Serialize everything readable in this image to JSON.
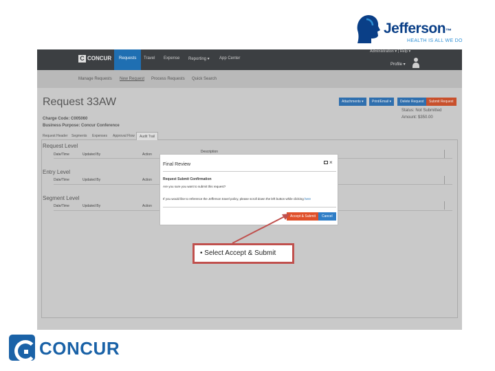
{
  "branding": {
    "jefferson_name": "Jefferson",
    "jefferson_tm": "™",
    "jefferson_tagline": "HEALTH IS ALL WE DO",
    "concur_logo_text": "CONCUR"
  },
  "topnav": {
    "brand": "CONCUR",
    "tabs": [
      "Requests",
      "Travel",
      "Expense",
      "Reporting ▾",
      "App Center"
    ],
    "active_tab": "Requests",
    "admin_text": "Administration ▾   |   Help ▾",
    "profile_text": "Profile ▾"
  },
  "subnav": {
    "items": [
      "Manage Requests",
      "New Request",
      "Process Requests",
      "Quick Search"
    ]
  },
  "request": {
    "title": "Request 33AW",
    "charge_code": "Charge Code: C005060",
    "business_purpose": "Business Purpose: Concur Conference",
    "buttons": [
      "Attachments ▾",
      "Print/Email ▾",
      "Delete Request",
      "Submit Request"
    ],
    "status": "Status: Not Submitted",
    "amount": "Amount: $350.00"
  },
  "detail_tabs": [
    "Request Header",
    "Segments",
    "Expenses",
    "Approval Flow",
    "Audit Trail"
  ],
  "audit_sections": [
    {
      "title": "Request Level",
      "cols": [
        "Date/Time",
        "Updated By",
        "Action",
        "Description"
      ]
    },
    {
      "title": "Entry Level",
      "cols": [
        "Date/Time",
        "Updated By",
        "Action"
      ]
    },
    {
      "title": "Segment Level",
      "cols": [
        "Date/Time",
        "Updated By",
        "Action"
      ]
    }
  ],
  "modal": {
    "title": "Final Review",
    "close": "×",
    "heading": "Request Submit Confirmation",
    "question": "Are you sure you want to submit this request?",
    "info_prefix": "If you would like to reference the Jefferson travel policy, please scroll down the left button while clicking ",
    "info_link": "here",
    "accept_label": "Accept & Submit",
    "cancel_label": "Cancel"
  },
  "callout": {
    "text": "• Select Accept & Submit"
  },
  "colors": {
    "nav_dark": "#3c3f42",
    "nav_active": "#1f6fb2",
    "accept": "#e0502a",
    "cancel": "#2f7ec7",
    "callout_border": "#c0504d",
    "jefferson_blue": "#0a3f87"
  }
}
